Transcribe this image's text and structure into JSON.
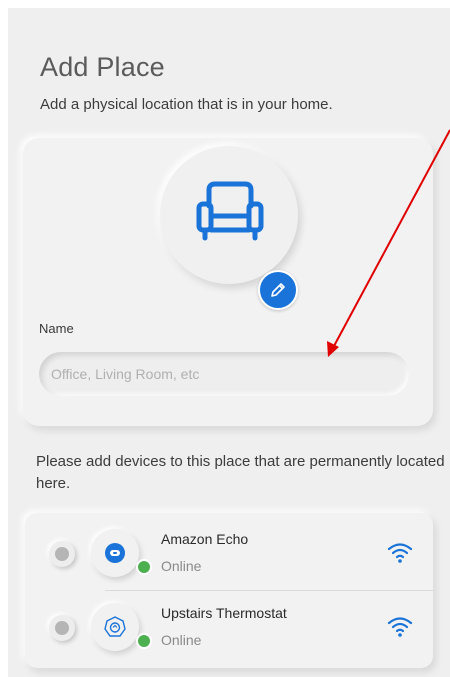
{
  "header": {
    "title": "Add Place",
    "subtitle": "Add a physical location that is in your home."
  },
  "place_form": {
    "icon": "armchair-icon",
    "edit_icon": "pencil-icon",
    "name_label": "Name",
    "name_value": "",
    "name_placeholder": "Office, Living Room, etc"
  },
  "instructions": "Please add devices to this place that are permanently located here.",
  "devices": [
    {
      "name": "Amazon Echo",
      "status": "Online",
      "icon": "echo-speaker-icon",
      "selected": false,
      "signal_icon": "wifi-icon"
    },
    {
      "name": "Upstairs Thermostat",
      "status": "Online",
      "icon": "thermostat-icon",
      "selected": false,
      "signal_icon": "wifi-icon"
    }
  ],
  "colors": {
    "accent": "#1a73d9",
    "online": "#4caf50",
    "annotation_arrow": "#e00000",
    "background": "#efefef"
  }
}
